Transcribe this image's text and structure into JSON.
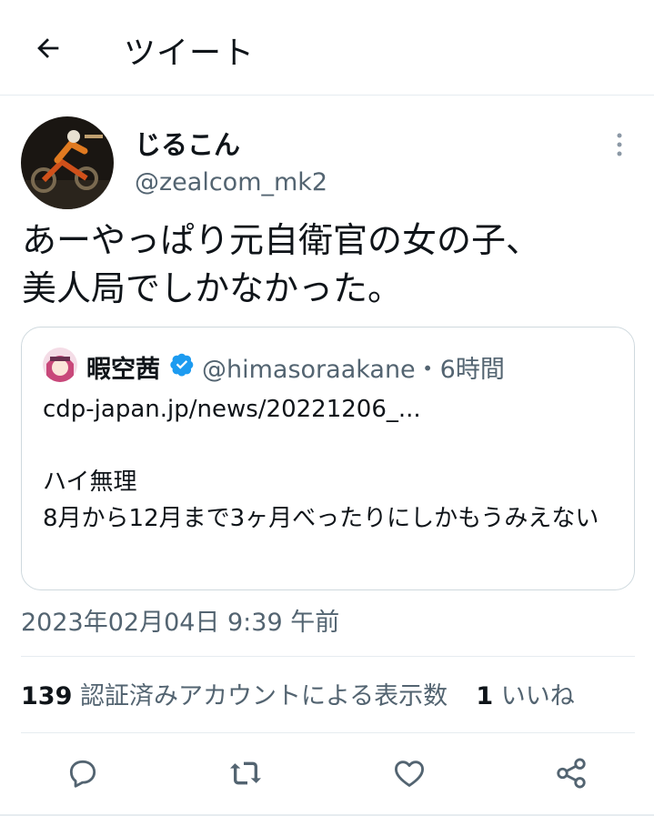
{
  "header": {
    "title": "ツイート",
    "back_icon": "arrow-left-icon"
  },
  "tweet": {
    "display_name": "じるこん",
    "handle": "@zealcom_mk2",
    "text": "あーやっぱり元自衛官の女の子、\n美人局でしかなかった。",
    "timestamp": "2023年02月04日 9:39 午前"
  },
  "quote": {
    "display_name": "暇空茜",
    "handle_time": "@himasoraakane・6時間",
    "body": "cdp-japan.jp/news/20221206_...\n\nハイ無理\n8月から12月まで3ヶ月べったりにしかもうみえない",
    "verified_color": "#1d9bf0"
  },
  "stats": {
    "views_count": "139",
    "views_label": "認証済みアカウントによる表示数",
    "likes_count": "1",
    "likes_label": "いいね"
  },
  "actions": [
    "reply-icon",
    "retweet-icon",
    "like-icon",
    "share-icon"
  ],
  "colors": {
    "text": "#0f1419",
    "secondary": "#536471",
    "border": "#cfd9de",
    "accent": "#1d9bf0"
  }
}
